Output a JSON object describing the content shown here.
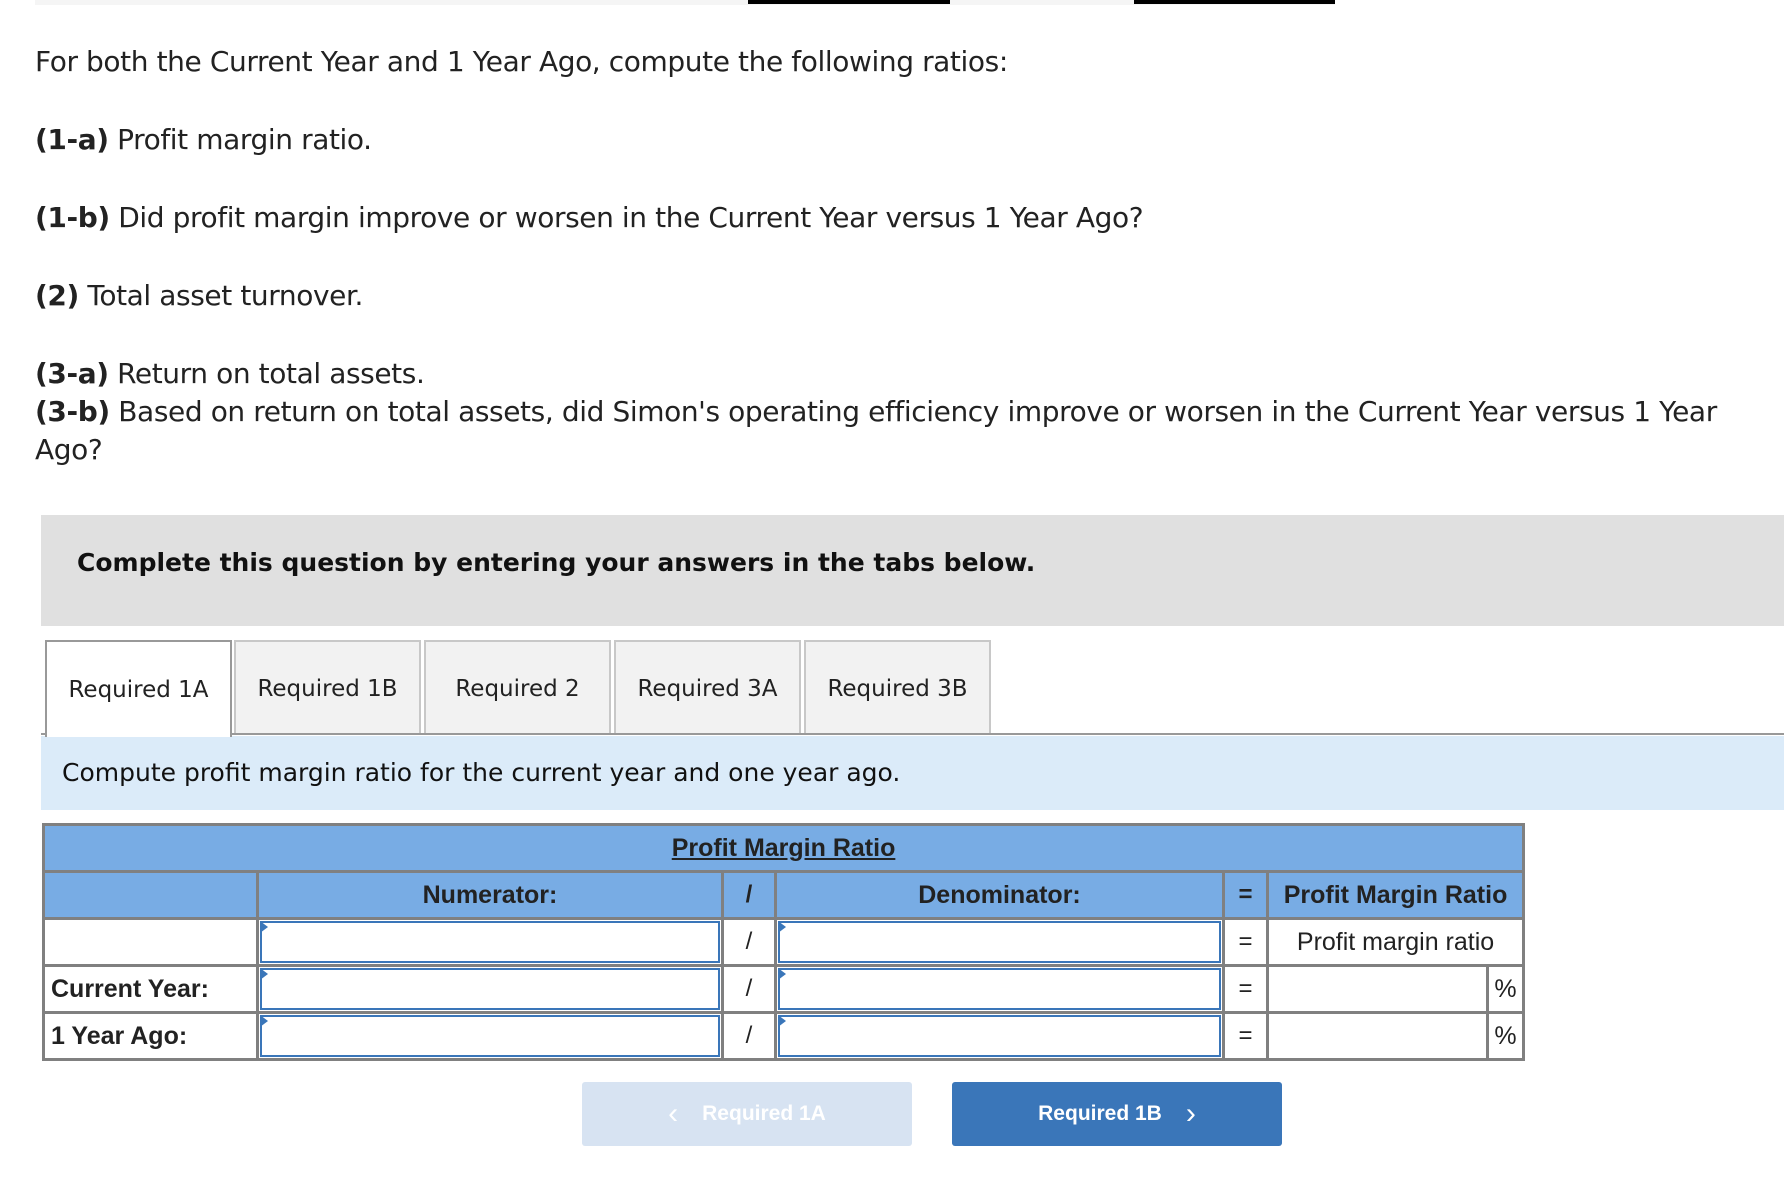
{
  "question": {
    "intro": "For both the Current Year and 1 Year Ago, compute the following ratios:",
    "parts": [
      {
        "label": "(1-a)",
        "text": " Profit margin ratio."
      },
      {
        "label": "(1-b)",
        "text": " Did profit margin improve or worsen in the Current Year versus 1 Year Ago?"
      },
      {
        "label": "(2)",
        "text": " Total asset turnover."
      },
      {
        "label": "(3-a)",
        "text": " Return on total assets."
      },
      {
        "label": "(3-b)",
        "text": " Based on return on total assets, did Simon's operating efficiency improve or worsen in the Current Year versus 1 Year Ago?"
      }
    ]
  },
  "instructions": "Complete this question by entering your answers in the tabs below.",
  "tabs": [
    {
      "label": "Required 1A",
      "active": true
    },
    {
      "label": "Required 1B",
      "active": false
    },
    {
      "label": "Required 2",
      "active": false
    },
    {
      "label": "Required 3A",
      "active": false
    },
    {
      "label": "Required 3B",
      "active": false
    }
  ],
  "prompt": "Compute profit margin ratio for the current year and one year ago.",
  "table": {
    "title": "Profit Margin Ratio",
    "headers": {
      "numerator": "Numerator:",
      "divide": "/",
      "denominator": "Denominator:",
      "equals": "=",
      "result": "Profit Margin Ratio"
    },
    "rows": [
      {
        "label": "",
        "numerator": "",
        "denominator": "",
        "divide": "/",
        "equals": "=",
        "result": "Profit margin ratio",
        "unit": ""
      },
      {
        "label": "Current Year:",
        "numerator": "",
        "denominator": "",
        "divide": "/",
        "equals": "=",
        "result": "",
        "unit": "%"
      },
      {
        "label": "1 Year Ago:",
        "numerator": "",
        "denominator": "",
        "divide": "/",
        "equals": "=",
        "result": "",
        "unit": "%"
      }
    ]
  },
  "navigation": {
    "prev_label": "Required 1A",
    "next_label": "Required 1B",
    "prev_icon": "chevron-left-icon",
    "next_icon": "chevron-right-icon",
    "prev_glyph": "‹",
    "next_glyph": "›"
  },
  "colors": {
    "table_header": "#78ace4",
    "input_border": "#3a76b9",
    "prompt_band": "#dbebf9",
    "instruction_band": "#e0e0e0",
    "next_button": "#3a76b9",
    "prev_button_disabled": "#d7e3f2"
  }
}
